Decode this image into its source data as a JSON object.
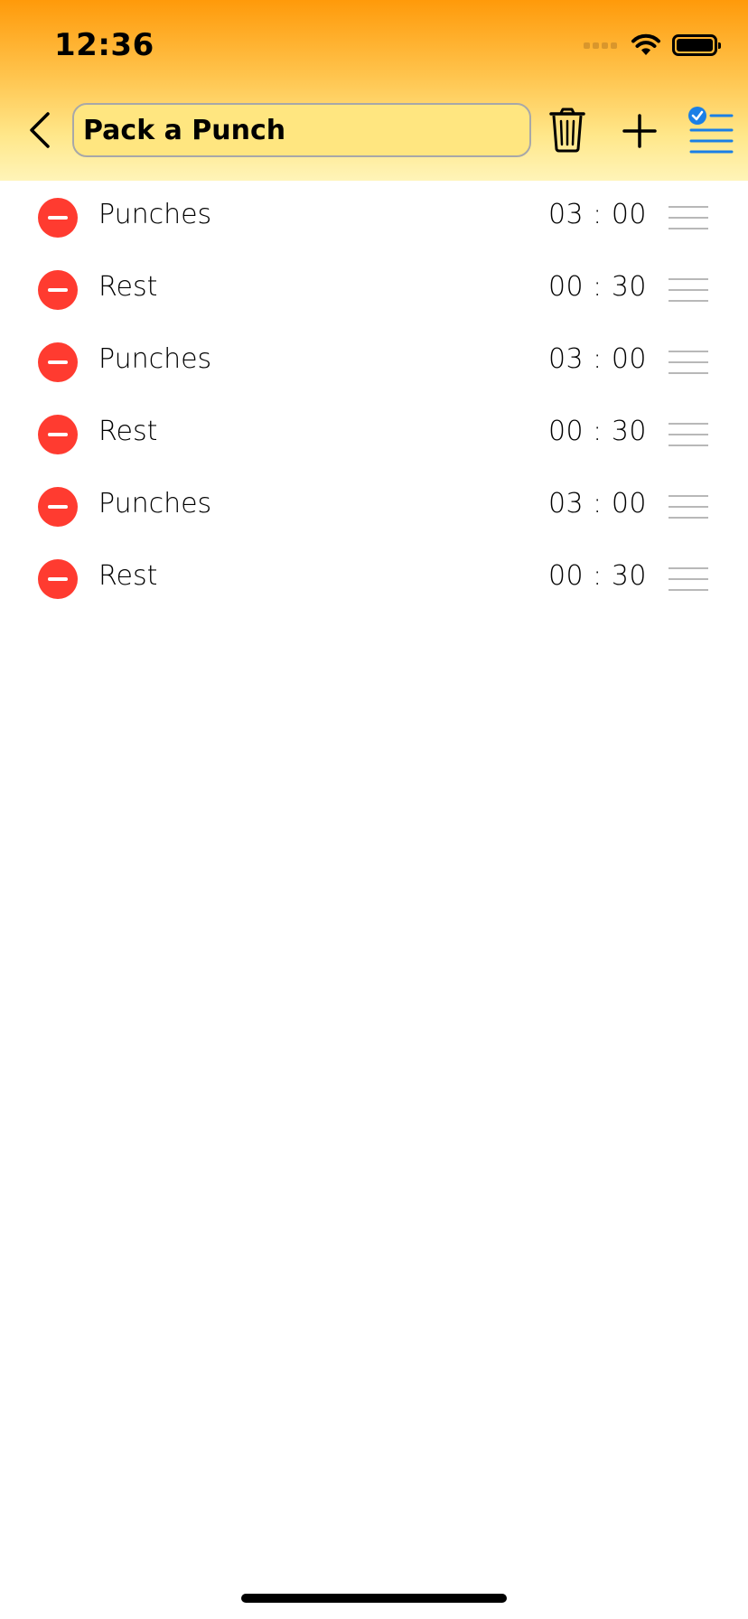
{
  "status_bar": {
    "time": "12:36"
  },
  "nav": {
    "title_value": "Pack a Punch",
    "back_icon": "chevron-left-icon",
    "trash_icon": "trash-icon",
    "add_icon": "plus-icon",
    "edit_icon": "checklist-icon"
  },
  "colors": {
    "header_gradient_top": "#ff9a0a",
    "header_gradient_bottom": "#fff4b8",
    "delete": "#ff3b30",
    "accent": "#1a7fe6"
  },
  "rows": [
    {
      "label": "Punches",
      "time": "03 : 00"
    },
    {
      "label": "Rest",
      "time": "00 : 30"
    },
    {
      "label": "Punches",
      "time": "03 : 00"
    },
    {
      "label": "Rest",
      "time": "00 : 30"
    },
    {
      "label": "Punches",
      "time": "03 : 00"
    },
    {
      "label": "Rest",
      "time": "00 : 30"
    }
  ]
}
